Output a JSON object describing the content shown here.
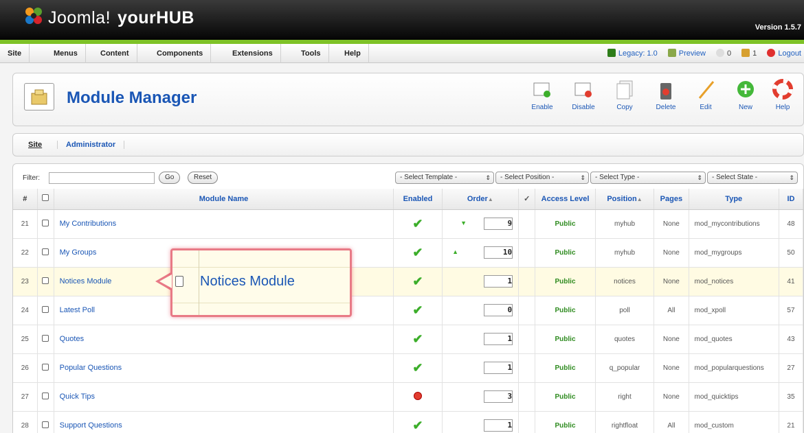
{
  "header": {
    "brand_joomla": "Joomla!",
    "brand_hub": "yourHUB",
    "version": "Version 1.5.7"
  },
  "menu": {
    "items": [
      "Site",
      "Menus",
      "Content",
      "Components",
      "Extensions",
      "Tools",
      "Help"
    ]
  },
  "status": {
    "legacy": "Legacy: 1.0",
    "preview": "Preview",
    "messages": "0",
    "users": "1",
    "logout": "Logout"
  },
  "toolbar": {
    "title": "Module Manager",
    "buttons": [
      "Enable",
      "Disable",
      "Copy",
      "Delete",
      "Edit",
      "New",
      "Help"
    ]
  },
  "subnav": {
    "site": "Site",
    "administrator": "Administrator"
  },
  "filter": {
    "label": "Filter:",
    "value": "",
    "go": "Go",
    "reset": "Reset",
    "select_template": "- Select Template -",
    "select_position": "- Select Position -",
    "select_type": "- Select Type -",
    "select_state": "- Select State -"
  },
  "table": {
    "headers": {
      "num": "#",
      "name": "Module Name",
      "enabled": "Enabled",
      "order": "Order",
      "access": "Access Level",
      "position": "Position",
      "pages": "Pages",
      "type": "Type",
      "id": "ID"
    },
    "rows": [
      {
        "num": "21",
        "name": "My Contributions",
        "enabled": true,
        "order": "9",
        "access": "Public",
        "position": "myhub",
        "pages": "None",
        "type": "mod_mycontributions",
        "id": "48"
      },
      {
        "num": "22",
        "name": "My Groups",
        "enabled": true,
        "order": "10",
        "access": "Public",
        "position": "myhub",
        "pages": "None",
        "type": "mod_mygroups",
        "id": "50"
      },
      {
        "num": "23",
        "name": "Notices Module",
        "enabled": true,
        "order": "1",
        "access": "Public",
        "position": "notices",
        "pages": "None",
        "type": "mod_notices",
        "id": "41"
      },
      {
        "num": "24",
        "name": "Latest Poll",
        "enabled": true,
        "order": "0",
        "access": "Public",
        "position": "poll",
        "pages": "All",
        "type": "mod_xpoll",
        "id": "57"
      },
      {
        "num": "25",
        "name": "Quotes",
        "enabled": true,
        "order": "1",
        "access": "Public",
        "position": "quotes",
        "pages": "None",
        "type": "mod_quotes",
        "id": "43"
      },
      {
        "num": "26",
        "name": "Popular Questions",
        "enabled": true,
        "order": "1",
        "access": "Public",
        "position": "q_popular",
        "pages": "None",
        "type": "mod_popularquestions",
        "id": "27"
      },
      {
        "num": "27",
        "name": "Quick Tips",
        "enabled": false,
        "order": "3",
        "access": "Public",
        "position": "right",
        "pages": "None",
        "type": "mod_quicktips",
        "id": "35"
      },
      {
        "num": "28",
        "name": "Support Questions",
        "enabled": true,
        "order": "1",
        "access": "Public",
        "position": "rightfloat",
        "pages": "All",
        "type": "mod_custom",
        "id": "21"
      }
    ]
  },
  "callout": {
    "text": "Notices Module"
  },
  "colors": {
    "accent_blue": "#1a56b5",
    "green_stripe": "#7ec227",
    "enabled_green": "#3cae2a",
    "callout_border": "#e87a86"
  }
}
